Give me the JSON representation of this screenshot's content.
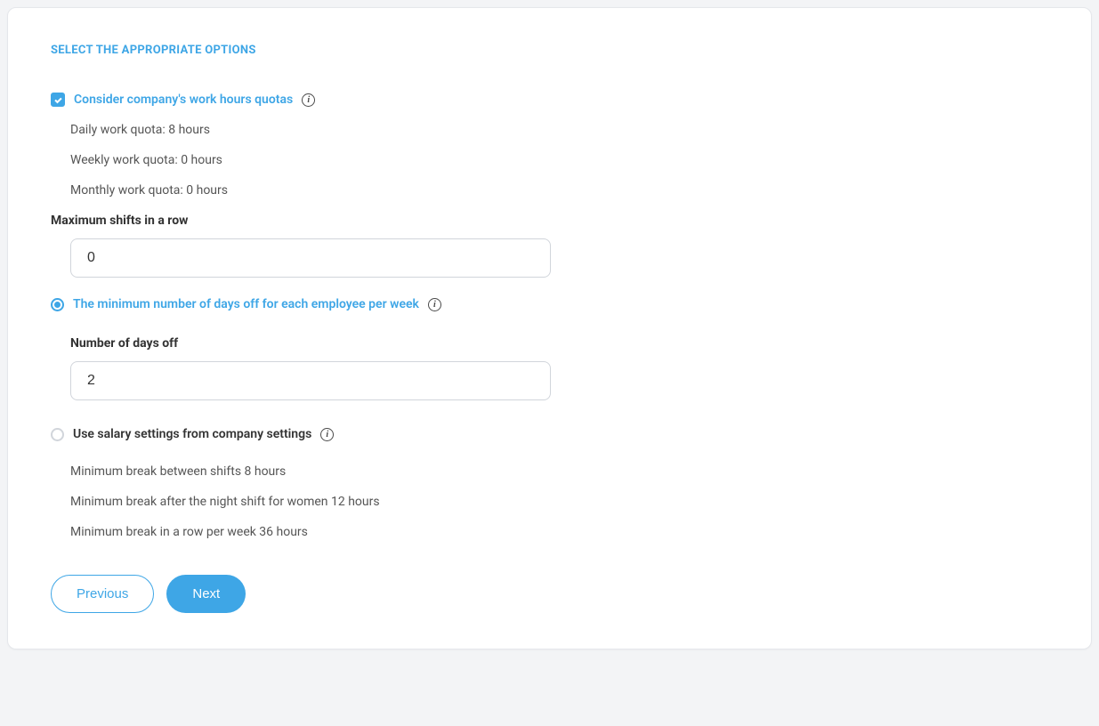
{
  "section_title": "SELECT THE APPROPRIATE OPTIONS",
  "quotas": {
    "label": "Consider company's work hours quotas",
    "daily": "Daily work quota: 8 hours",
    "weekly": "Weekly work quota: 0 hours",
    "monthly": "Monthly work quota: 0 hours"
  },
  "max_shifts": {
    "label": "Maximum shifts in a row",
    "value": "0"
  },
  "days_off": {
    "label": "The minimum number of days off for each employee per week",
    "field_label": "Number of days off",
    "value": "2"
  },
  "salary": {
    "label": "Use salary settings from company settings",
    "break_between": "Minimum break between shifts 8 hours",
    "break_night_women": "Minimum break after the night shift for women 12 hours",
    "break_per_week": "Minimum break in a row per week 36 hours"
  },
  "buttons": {
    "previous": "Previous",
    "next": "Next"
  }
}
